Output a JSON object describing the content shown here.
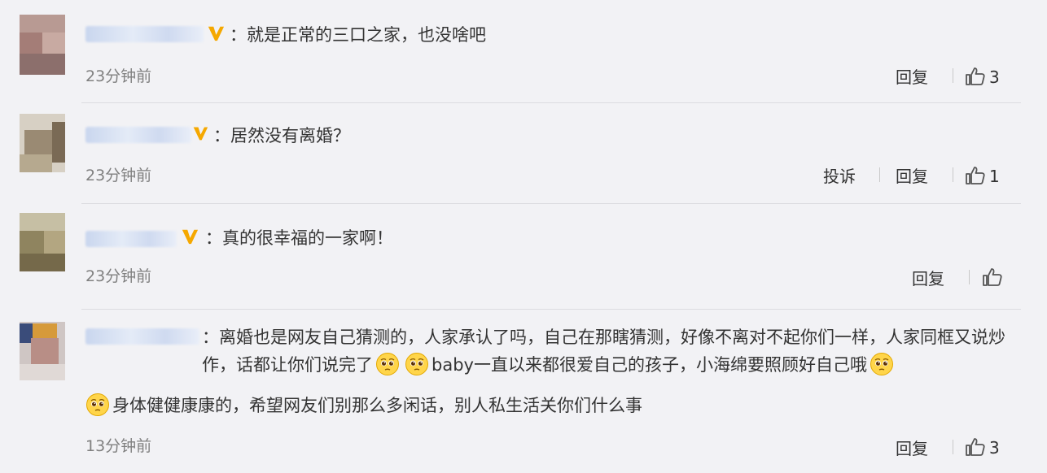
{
  "comments": [
    {
      "text": "：就是正常的三口之家，也没啥吧",
      "time": "23分钟前",
      "reply": "回复",
      "likes": "3"
    },
    {
      "text": "：居然没有离婚？",
      "time": "23分钟前",
      "report": "投诉",
      "reply": "回复",
      "likes": "1"
    },
    {
      "text": "：真的很幸福的一家啊！",
      "time": "23分钟前",
      "reply": "回复",
      "likes": ""
    },
    {
      "text_a": "：离婚也是网友自己猜测的，人家承认了吗，自己在那瞎猜测，好像不离对不起你们一样，人家同框又说炒作，话都让你们说完了",
      "text_b": "baby一直以来都很爱自己的孩子，小海绵要照顾好自己哦",
      "text_c": "身体健健康康的，希望网友们别那么多闲话，别人私生活关你们什么事",
      "time": "13分钟前",
      "reply": "回复",
      "likes": "3"
    }
  ],
  "icons": {
    "verified": "verified-v-icon",
    "like": "thumbs-up-icon",
    "emoji": "pleading-face-emoji"
  },
  "colors": {
    "verified": "#f5a800",
    "like_stroke": "#555555",
    "background": "#f2f2f5"
  }
}
